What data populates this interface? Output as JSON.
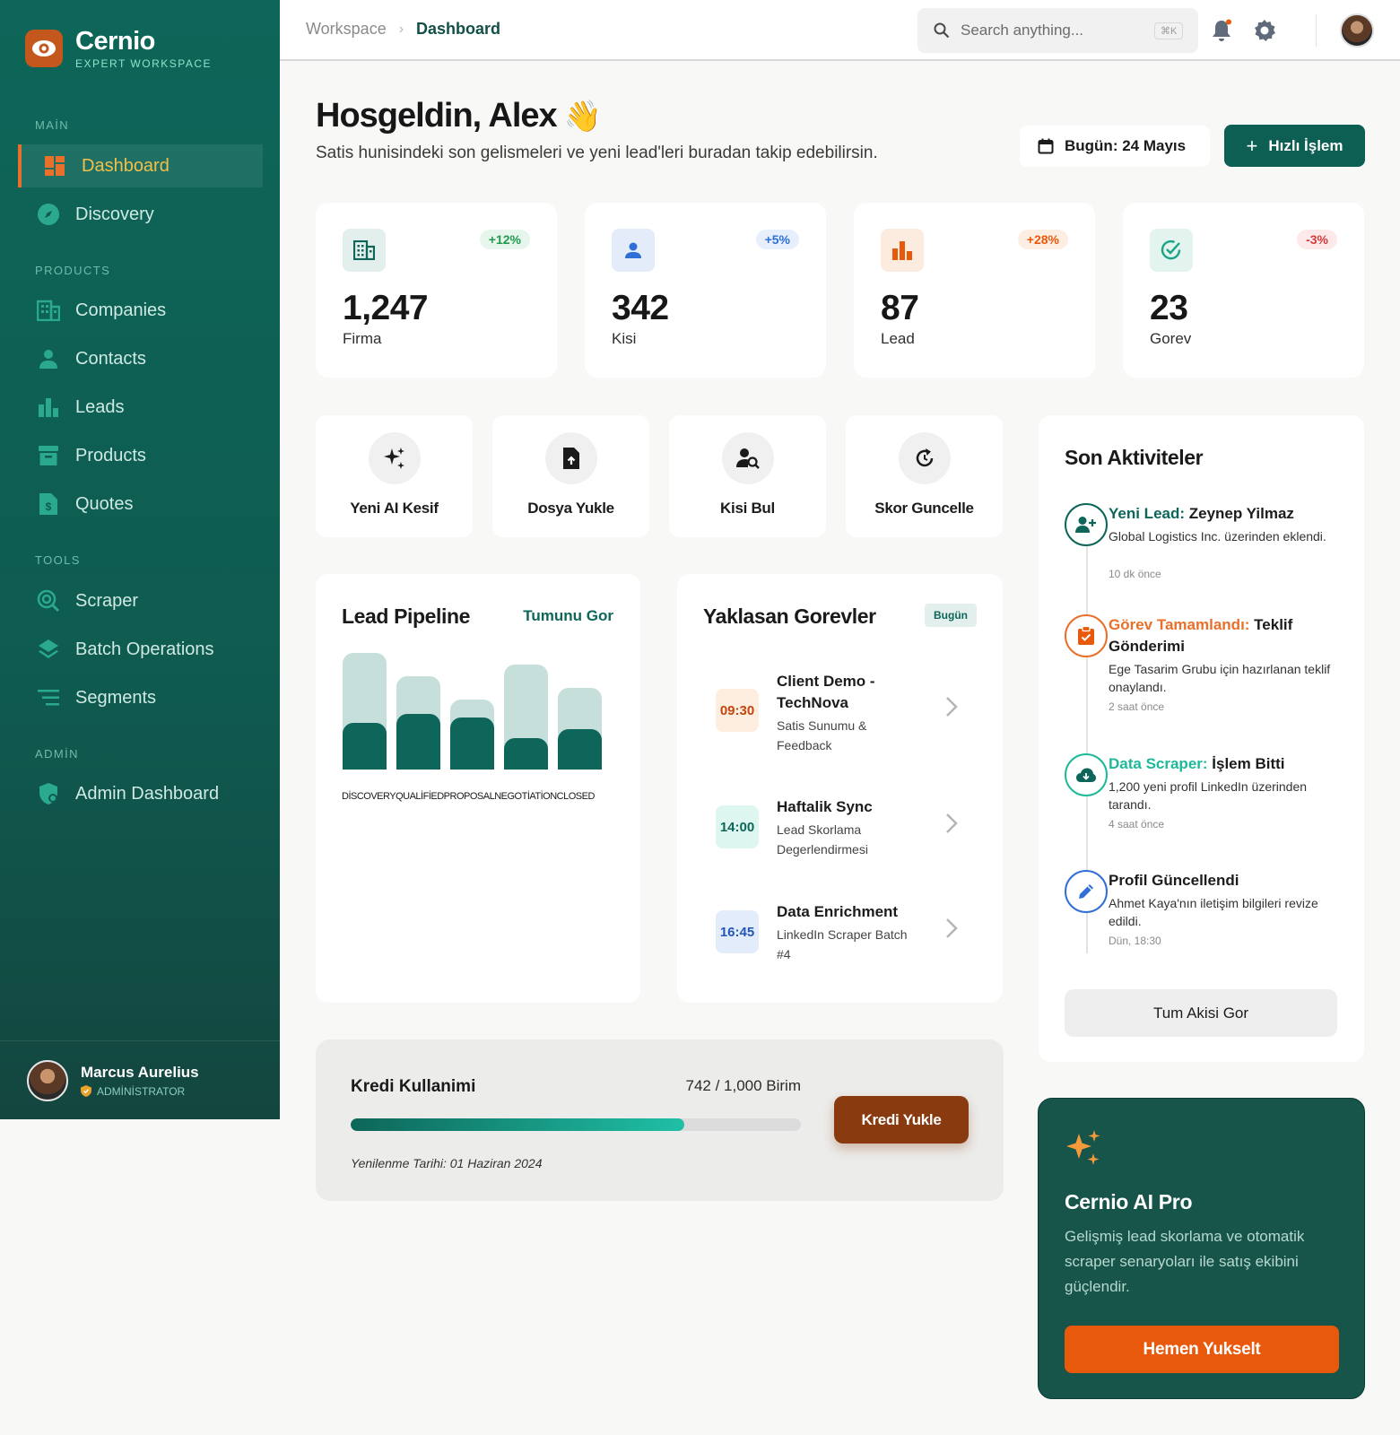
{
  "brand": {
    "name": "Cernio",
    "subtitle": "EXPERT WORKSPACE"
  },
  "sidebar": {
    "sections": {
      "main": "MAİN",
      "products": "PRODUCTS",
      "tools": "TOOLS",
      "admin": "ADMİN"
    },
    "items": {
      "dashboard": "Dashboard",
      "discovery": "Discovery",
      "companies": "Companies",
      "contacts": "Contacts",
      "leads": "Leads",
      "products": "Products",
      "quotes": "Quotes",
      "scraper": "Scraper",
      "batch": "Batch Operations",
      "segments": "Segments",
      "admin_dashboard": "Admin Dashboard"
    },
    "user": {
      "name": "Marcus Aurelius",
      "role": "ADMİNİSTRATOR"
    }
  },
  "header": {
    "breadcrumb": [
      "Workspace",
      "Dashboard"
    ],
    "search_placeholder": "Search anything...",
    "search_shortcut": "⌘K"
  },
  "welcome": {
    "title": "Hosgeldin, Alex",
    "emoji": "👋",
    "subtitle": "Satis hunisindeki son gelismeleri ve yeni lead'leri buradan takip edebilirsin.",
    "date_label": "Bugün: 24 Mayıs",
    "quick_action": "Hızlı İşlem"
  },
  "stats": [
    {
      "value": "1,247",
      "label": "Firma",
      "change": "+12%",
      "icon": "building-icon"
    },
    {
      "value": "342",
      "label": "Kisi",
      "change": "+5%",
      "icon": "person-icon"
    },
    {
      "value": "87",
      "label": "Lead",
      "change": "+28%",
      "icon": "bar-chart-icon"
    },
    {
      "value": "23",
      "label": "Gorev",
      "change": "-3%",
      "icon": "check-circle-icon"
    }
  ],
  "quick_actions": [
    {
      "label": "Yeni AI Kesif",
      "icon": "sparkles-icon"
    },
    {
      "label": "Dosya Yukle",
      "icon": "file-upload-icon"
    },
    {
      "label": "Kisi Bul",
      "icon": "person-search-icon"
    },
    {
      "label": "Skor Guncelle",
      "icon": "refresh-icon"
    }
  ],
  "pipeline": {
    "title": "Lead Pipeline",
    "link": "Tumunu Gor"
  },
  "chart_data": {
    "type": "bar",
    "title": "Lead Pipeline",
    "categories": [
      "DİSCOVERY",
      "QUALİFİED",
      "PROPOSAL",
      "NEGOTİATİON",
      "CLOSED"
    ],
    "series": [
      {
        "values": [
          100,
          80,
          60,
          90,
          70
        ]
      },
      {
        "values": [
          40,
          48,
          45,
          27,
          35
        ]
      }
    ],
    "ylim": [
      0,
      100
    ],
    "colors": [
      "#c7dfdb",
      "#0d6659"
    ]
  },
  "tasks": {
    "title": "Yaklasan Gorevler",
    "badge": "Bugün",
    "items": [
      {
        "time": "09:30",
        "title": "Client Demo - TechNova",
        "subtitle": "Satis Sunumu & Feedback"
      },
      {
        "time": "14:00",
        "title": "Haftalik Sync",
        "subtitle": "Lead Skorlama Degerlendirmesi"
      },
      {
        "time": "16:45",
        "title": "Data Enrichment",
        "subtitle": "LinkedIn Scraper Batch #4"
      }
    ]
  },
  "activity": {
    "title": "Son Aktiviteler",
    "items": [
      {
        "prefix": "Yeni Lead:",
        "rest": " Zeynep Yilmaz",
        "desc": "Global Logistics Inc. üzerinden eklendi.",
        "time": "10 dk önce",
        "color": "#0d6659"
      },
      {
        "prefix": "Görev Tamamlandı:",
        "rest": " Teklif Gönderimi",
        "desc": "Ege Tasarim Grubu için hazırlanan teklif onaylandı.",
        "time": "2 saat önce",
        "color": "#e8702a"
      },
      {
        "prefix": "Data Scraper:",
        "rest": " İşlem Bitti",
        "desc": "1,200 yeni profil LinkedIn üzerinden tarandı.",
        "time": "4 saat önce",
        "color": "#1fb89a"
      },
      {
        "prefix": "",
        "rest": "Profil Güncellendi",
        "desc": "Ahmet Kaya'nın iletişim bilgileri revize edildi.",
        "time": "Dün, 18:30",
        "color": "#2f6fd6"
      }
    ],
    "button": "Tum Akisi Gor"
  },
  "credit": {
    "title": "Kredi Kullanimi",
    "value": "742 / 1,000 Birim",
    "fraction": 0.742,
    "renewal": "Yenilenme Tarihi: 01 Haziran 2024",
    "button": "Kredi Yukle"
  },
  "pro": {
    "title": "Cernio AI Pro",
    "description": "Gelişmiş lead skorlama ve otomatik scraper senaryoları ile satış ekibini güçlendir.",
    "button": "Hemen Yukselt"
  }
}
